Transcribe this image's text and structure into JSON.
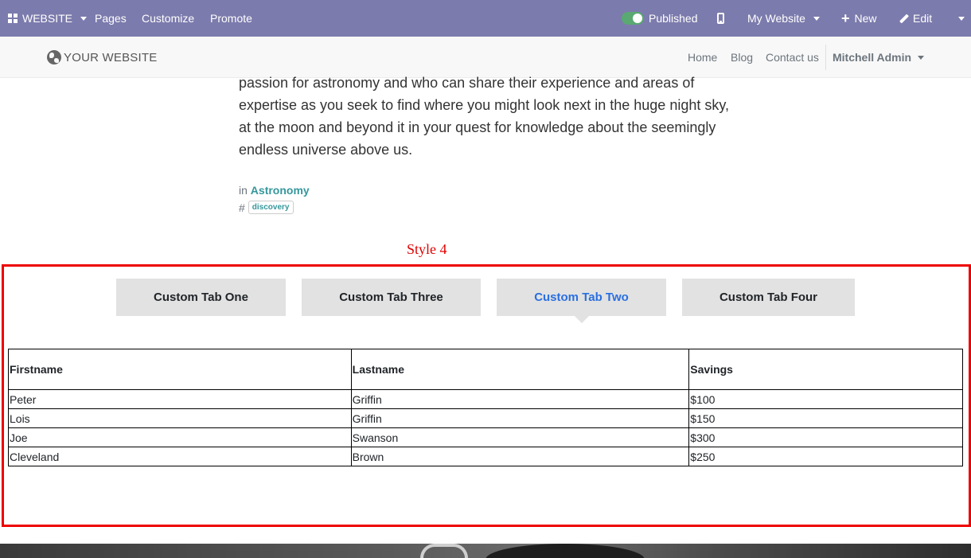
{
  "adminbar": {
    "apps_label": "WEBSITE",
    "menu": [
      "Pages",
      "Customize",
      "Promote"
    ],
    "published_label": "Published",
    "site_selector": "My Website",
    "new_label": "New",
    "edit_label": "Edit",
    "colors": {
      "bar": "#7c7bad",
      "toggle_on": "#5aa872"
    }
  },
  "header": {
    "logo_text": "YOUR WEBSITE",
    "nav": [
      "Home",
      "Blog",
      "Contact us"
    ],
    "user": "Mitchell Admin"
  },
  "post": {
    "paragraph_lines": [
      "passion for astronomy and who can share their experience and areas of",
      "expertise as you seek to find where you might look next in the huge night sky,",
      "at the moon and beyond it in your quest for knowledge about the seemingly",
      "endless universe above us."
    ],
    "category_prefix": "in",
    "category": "Astronomy",
    "tag_prefix": "#",
    "tag": "discovery"
  },
  "snippet": {
    "style_label": "Style 4",
    "tabs": [
      "Custom Tab One",
      "Custom Tab Three",
      "Custom Tab Two",
      "Custom Tab Four"
    ],
    "active_tab": "Custom Tab Two",
    "table": {
      "headers": [
        "Firstname",
        "Lastname",
        "Savings"
      ],
      "rows": [
        [
          "Peter",
          "Griffin",
          "$100"
        ],
        [
          "Lois",
          "Griffin",
          "$150"
        ],
        [
          "Joe",
          "Swanson",
          "$300"
        ],
        [
          "Cleveland",
          "Brown",
          "$250"
        ]
      ]
    },
    "colors": {
      "frame": "#ee0000",
      "active_tab": "#2a6fe0",
      "tab_bg": "#e2e2e2"
    }
  }
}
